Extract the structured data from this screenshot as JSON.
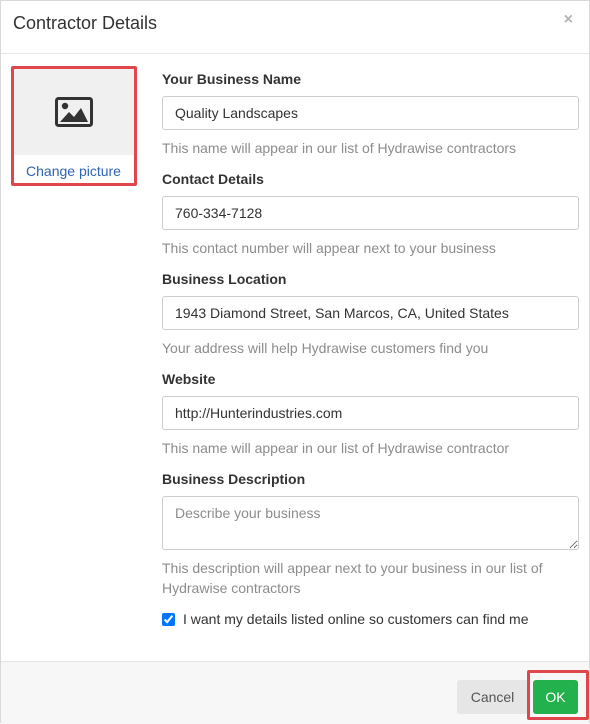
{
  "dialog": {
    "title": "Contractor Details",
    "close_glyph": "×"
  },
  "picture": {
    "icon": "image-icon",
    "link_label": "Change picture"
  },
  "fields": {
    "business_name": {
      "label": "Your Business Name",
      "value": "Quality Landscapes",
      "help": "This name will appear in our list of Hydrawise contractors"
    },
    "contact": {
      "label": "Contact Details",
      "value": "760-334-7128",
      "help": "This contact number will appear next to your business"
    },
    "location": {
      "label": "Business Location",
      "value": "1943 Diamond Street, San Marcos, CA, United States",
      "help": "Your address will help Hydrawise customers find you"
    },
    "website": {
      "label": "Website",
      "value": "http://Hunterindustries.com",
      "help": "This name will appear in our list of Hydrawise contractor"
    },
    "description": {
      "label": "Business Description",
      "placeholder": "Describe your business",
      "help": "This description will appear next to your business in our list of Hydrawise contractors"
    }
  },
  "listing_checkbox": {
    "checked": true,
    "label": "I want my details listed online so customers can find me"
  },
  "footer": {
    "cancel_label": "Cancel",
    "ok_label": "OK"
  },
  "colors": {
    "link": "#2f63b5",
    "ok_button": "#23b14d",
    "highlight_frame": "#e0474c",
    "help_text": "#8c8c8c"
  }
}
